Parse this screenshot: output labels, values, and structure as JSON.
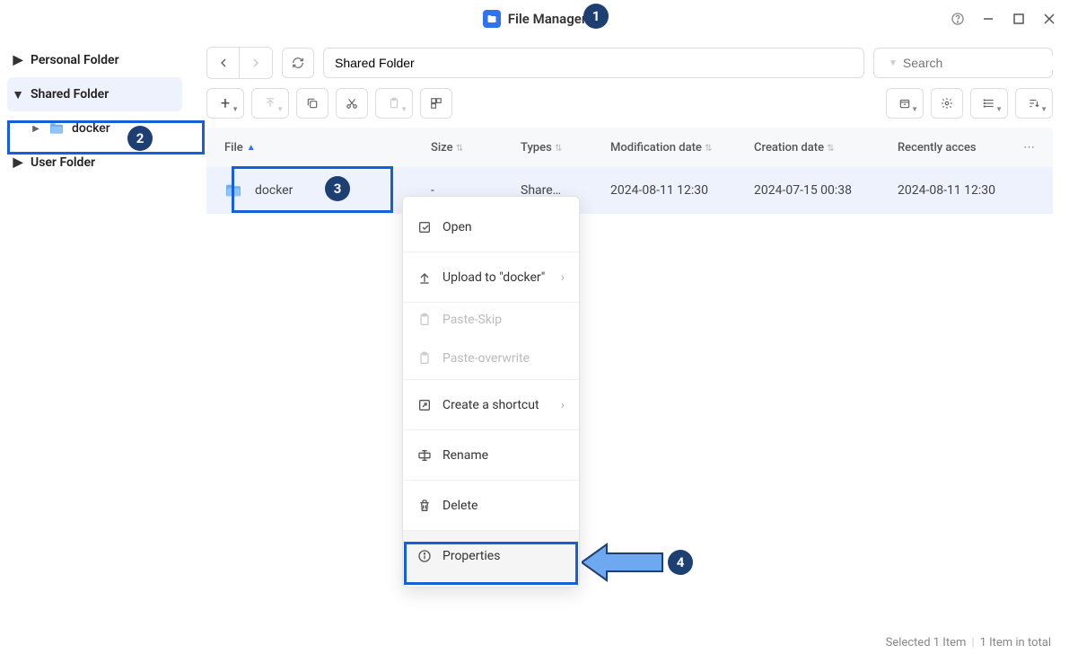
{
  "app": {
    "title": "File Manager"
  },
  "sidebar": {
    "items": [
      {
        "label": "Personal Folder"
      },
      {
        "label": "Shared Folder"
      },
      {
        "label": "docker"
      },
      {
        "label": "User Folder"
      }
    ]
  },
  "breadcrumb": {
    "value": "Shared Folder"
  },
  "search": {
    "placeholder": "Search"
  },
  "table": {
    "headers": {
      "file": "File",
      "size": "Size",
      "types": "Types",
      "mod": "Modification date",
      "create": "Creation date",
      "recent": "Recently acces"
    },
    "rows": [
      {
        "name": "docker",
        "size": "-",
        "types": "Share…",
        "mod": "2024-08-11 12:30",
        "create": "2024-07-15 00:38",
        "recent": "2024-08-11 12:30"
      }
    ]
  },
  "context_menu": {
    "open": "Open",
    "upload": "Upload to \"docker\"",
    "paste_skip": "Paste-Skip",
    "paste_over": "Paste-overwrite",
    "shortcut": "Create a shortcut",
    "rename": "Rename",
    "delete": "Delete",
    "properties": "Properties"
  },
  "status": {
    "selected": "Selected 1 Item",
    "total": "1 Item in total"
  },
  "badges": {
    "b1": "1",
    "b2": "2",
    "b3": "3",
    "b4": "4"
  }
}
